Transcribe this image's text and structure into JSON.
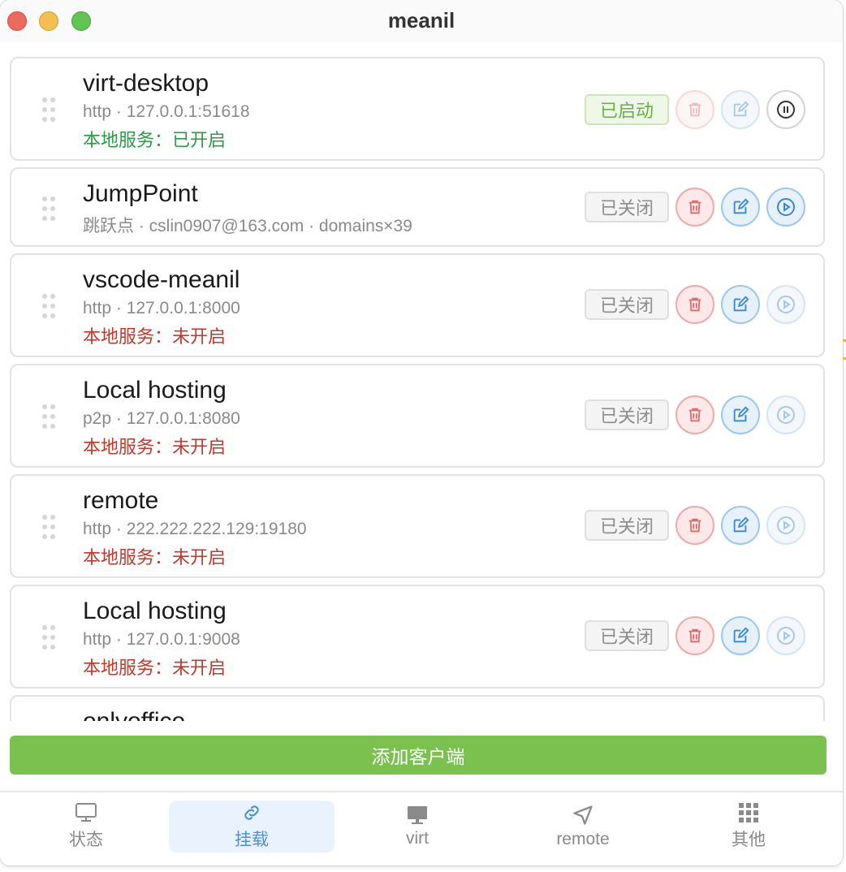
{
  "window": {
    "title": "meanil"
  },
  "clients": [
    {
      "name": "virt-desktop",
      "subtitle": "http · 127.0.0.1:51618",
      "service": "本地服务：已开启",
      "service_state": "on",
      "status": "已启动",
      "running": true
    },
    {
      "name": "JumpPoint",
      "subtitle": "跳跃点 · cslin0907@163.com · domains×39",
      "service": "",
      "service_state": "none",
      "status": "已关闭",
      "running": false
    },
    {
      "name": "vscode-meanil",
      "subtitle": "http · 127.0.0.1:8000",
      "service": "本地服务：未开启",
      "service_state": "off",
      "status": "已关闭",
      "running": false
    },
    {
      "name": "Local hosting",
      "subtitle": "p2p · 127.0.0.1:8080",
      "service": "本地服务：未开启",
      "service_state": "off",
      "status": "已关闭",
      "running": false
    },
    {
      "name": "remote",
      "subtitle": "http · 222.222.222.129:19180",
      "service": "本地服务：未开启",
      "service_state": "off",
      "status": "已关闭",
      "running": false
    },
    {
      "name": "Local hosting",
      "subtitle": "http · 127.0.0.1:9008",
      "service": "本地服务：未开启",
      "service_state": "off",
      "status": "已关闭",
      "running": false
    },
    {
      "name": "onlyoffice"
    }
  ],
  "actions": {
    "add_client": "添加客户端"
  },
  "tabs": [
    {
      "label": "状态",
      "icon": "monitor-icon"
    },
    {
      "label": "挂载",
      "icon": "link-icon",
      "active": true
    },
    {
      "label": "virt",
      "icon": "desktop-filled-icon"
    },
    {
      "label": "remote",
      "icon": "navigation-icon"
    },
    {
      "label": "其他",
      "icon": "grid-icon"
    }
  ],
  "colors": {
    "accent_green": "#7bc14f",
    "active_blue": "#4a90d9",
    "danger_red": "#c0392b",
    "service_green": "#2e9a48"
  }
}
